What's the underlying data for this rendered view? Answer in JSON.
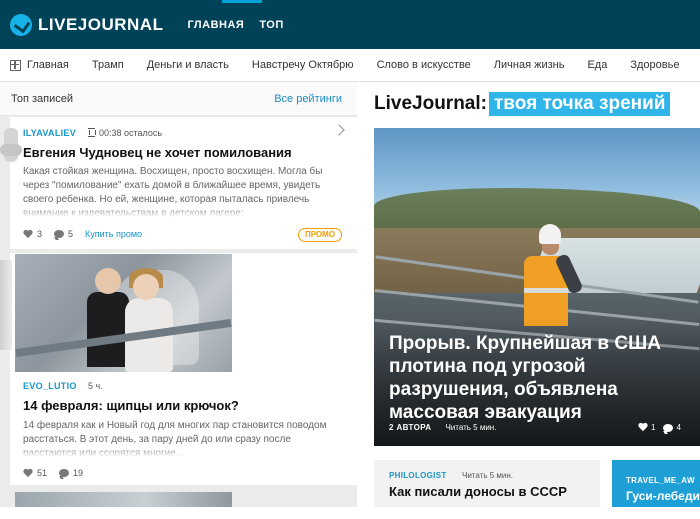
{
  "header": {
    "logo_text": "LIVEJOURNAL",
    "nav": [
      "ГЛАВНАЯ",
      "ТОП"
    ]
  },
  "categories": [
    "Главная",
    "Трамп",
    "Деньги и власть",
    "Навстречу Октябрю",
    "Слово в искусстве",
    "Личная жизнь",
    "Еда",
    "Здоровье"
  ],
  "top_posts": {
    "title": "Топ записей",
    "all_ratings": "Все рейтинги"
  },
  "post1": {
    "author": "ILYAVALIEV",
    "time_left": "00:38 осталось",
    "title": "Евгения Чудновец не хочет помилования",
    "body": "Какая стойкая женщина. Восхищен, просто восхищен. Могла бы через \"помилование\" ехать домой в ближайшее время, увидеть своего ребенка. Но ей, женщине, которая пыталась привлечь внимание к издевательствам в детском лагере:",
    "likes": "3",
    "comments": "5",
    "buy_promo": "Купить промо",
    "promo_badge": "ПРОМО"
  },
  "post2": {
    "author": "EVO_LUTIO",
    "time": "5 ч.",
    "title": "14 февраля: щипцы или крючок?",
    "body": "14 февраля как и Новый год для многих пар становится поводом расстаться. В этот день, за пару дней до или сразу после расстаются или ссорятся многие...",
    "likes": "51",
    "comments": "19"
  },
  "tagline": {
    "prefix": "LiveJournal:",
    "highlight": "твоя точка зрений"
  },
  "hero": {
    "title": "Прорыв. Крупнейшая в США плотина под угрозой разрушения, объявлена массовая эвакуация",
    "authors": "2 АВТОРА",
    "read_time": "Читать 5 мин.",
    "likes": "1",
    "comments": "4"
  },
  "card3": {
    "author": "PHILOLOGIST",
    "read_time": "Читать 5 мин.",
    "title": "Как писали доносы в СССР"
  },
  "card4": {
    "author": "TRAVEL_ME_AW",
    "title": "Гуси-лебеди"
  }
}
